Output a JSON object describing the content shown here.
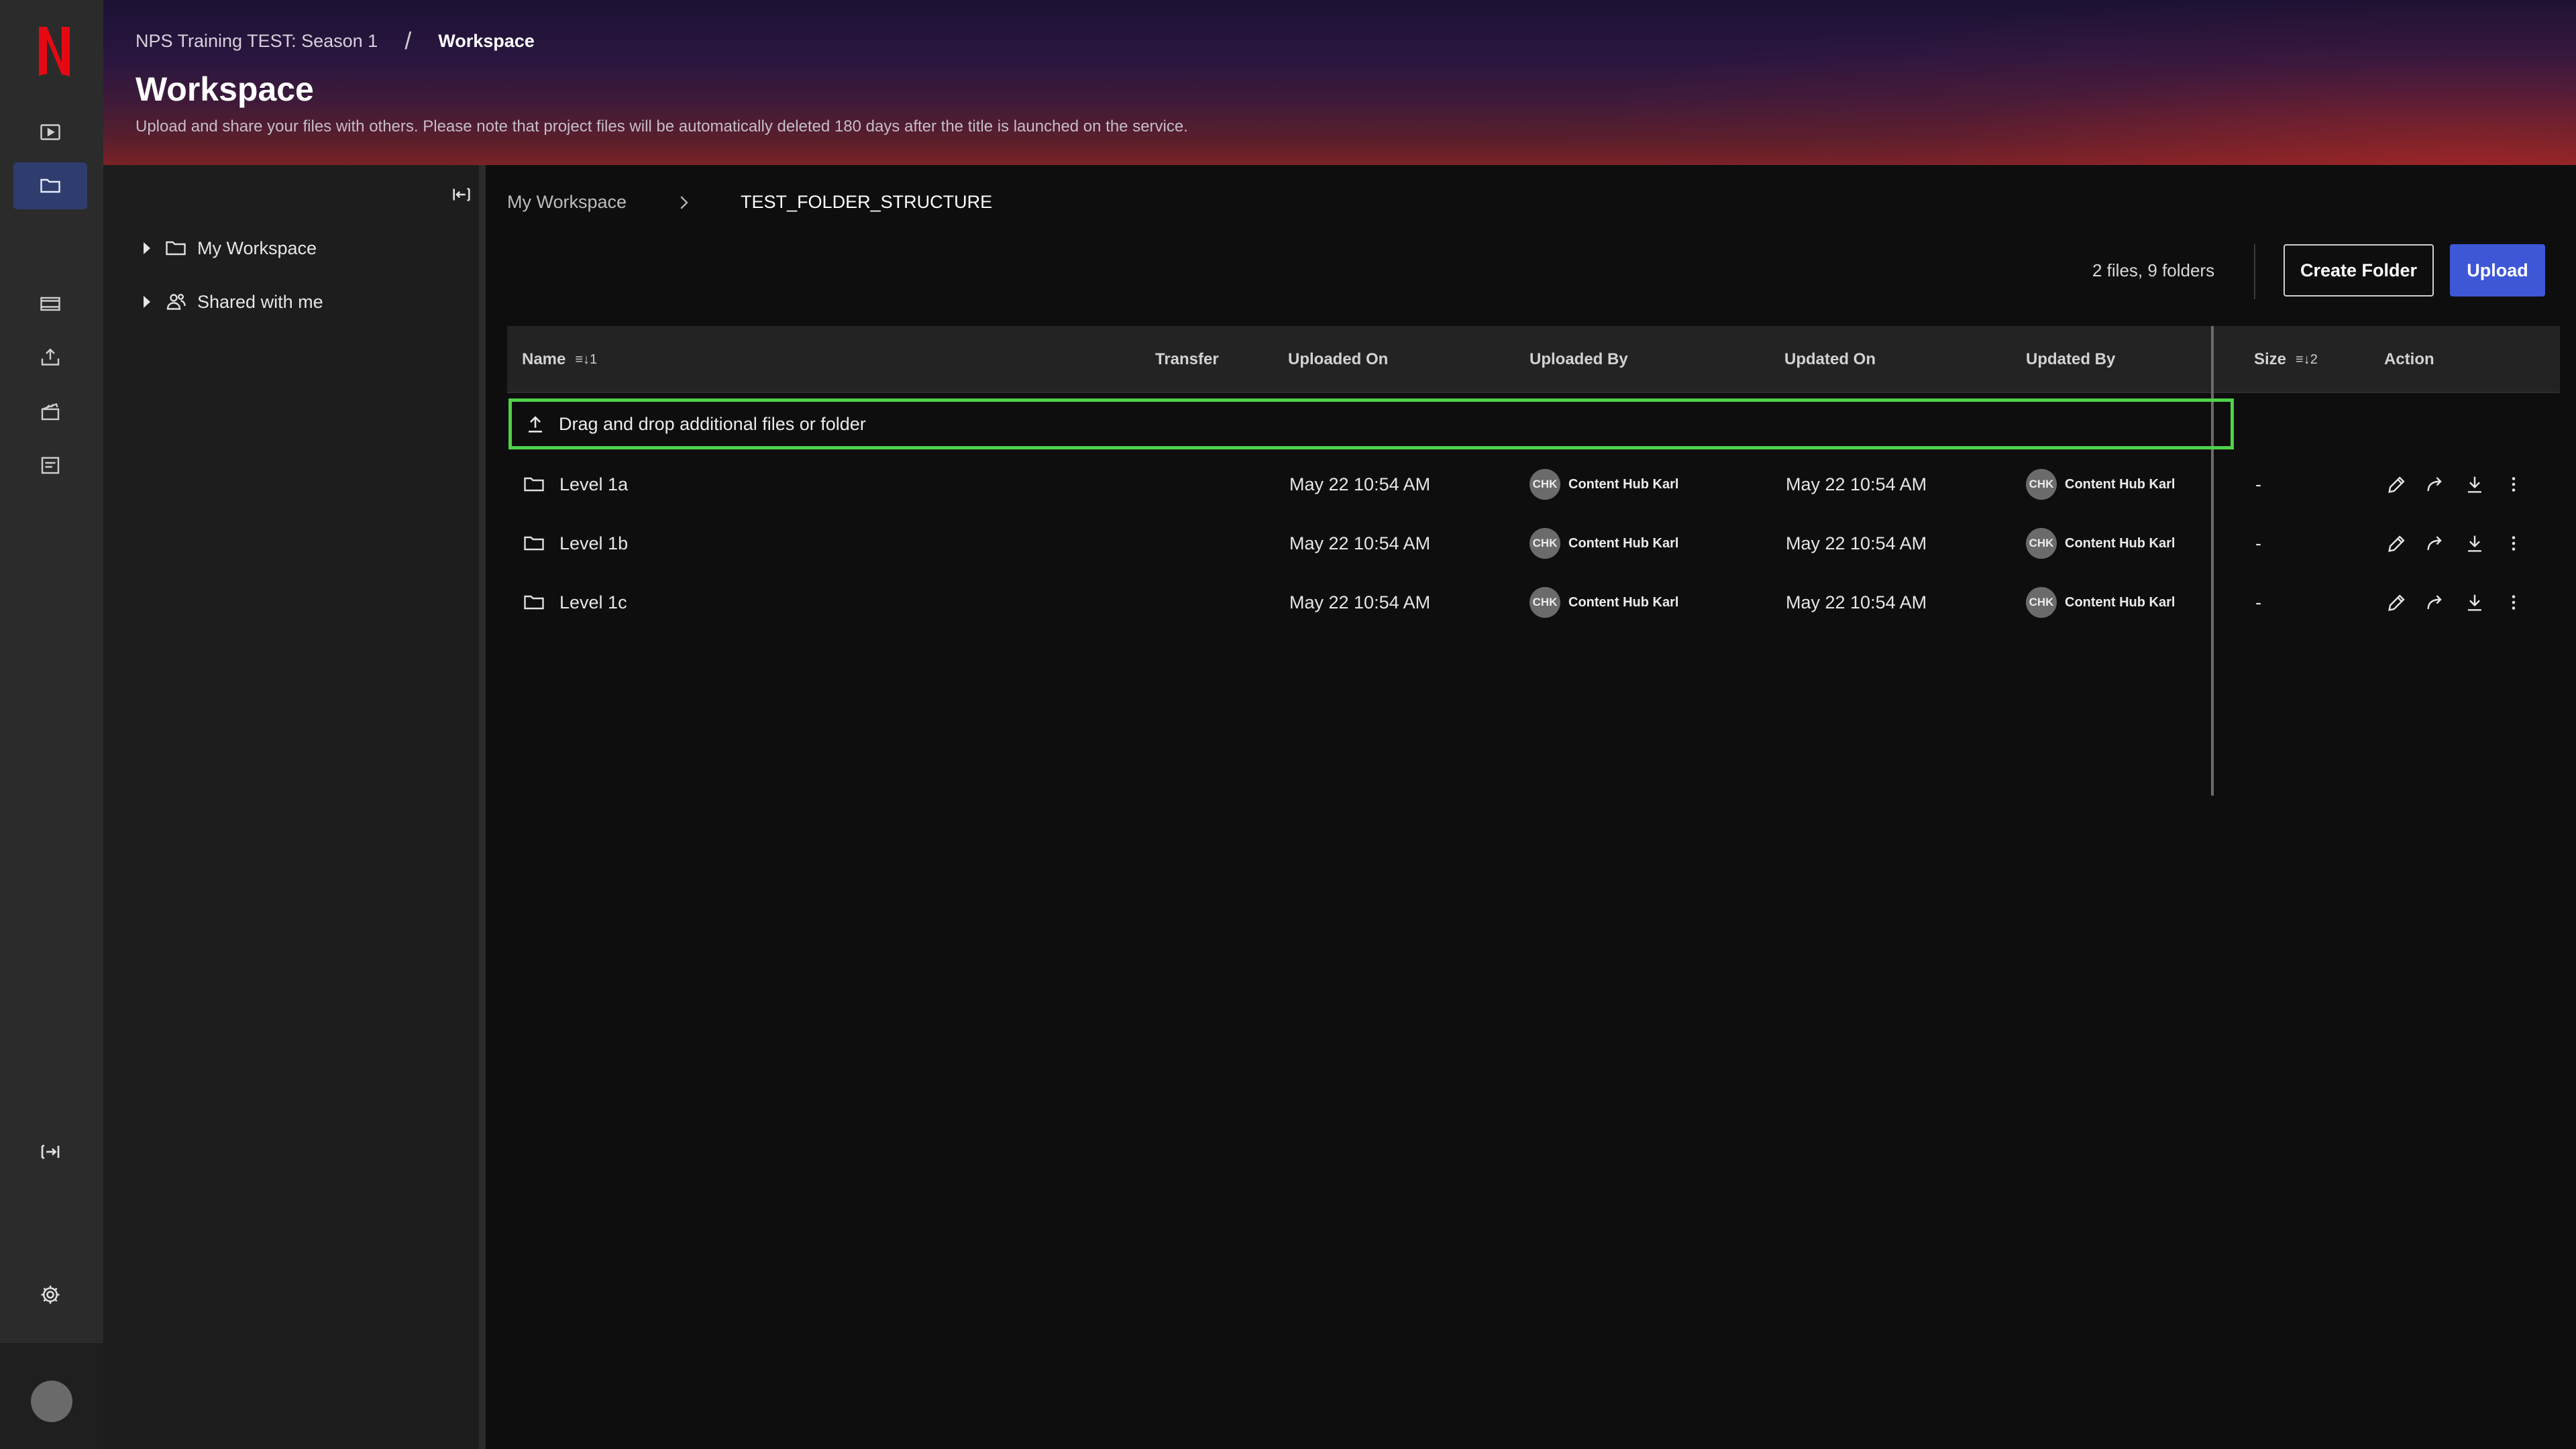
{
  "header": {
    "breadcrumb_project": "NPS Training TEST: Season 1",
    "breadcrumb_separator": "/",
    "breadcrumb_current": "Workspace",
    "title": "Workspace",
    "subtitle": "Upload and share your files with others. Please note that project files will be automatically deleted 180 days after the title is launched on the service."
  },
  "tree": {
    "items": [
      {
        "label": "My Workspace",
        "icon": "folder-icon"
      },
      {
        "label": "Shared with me",
        "icon": "people-icon"
      }
    ]
  },
  "path": {
    "root": "My Workspace",
    "current": "TEST_FOLDER_STRUCTURE"
  },
  "toolbar": {
    "count": "2 files, 9 folders",
    "create_folder": "Create Folder",
    "upload": "Upload"
  },
  "table": {
    "headers": {
      "name": "Name",
      "name_sort": "≡↓1",
      "transfer": "Transfer",
      "uploaded_on": "Uploaded On",
      "uploaded_by": "Uploaded By",
      "updated_on": "Updated On",
      "updated_by": "Updated By",
      "size": "Size",
      "size_sort": "≡↓2",
      "action": "Action"
    },
    "dropzone": "Drag and drop additional files or folder",
    "rows": [
      {
        "name": "Level 1a",
        "uploaded_on": "May 22 10:54 AM",
        "uploaded_by_initials": "CHK",
        "uploaded_by": "Content Hub Karl",
        "updated_on": "May 22 10:54 AM",
        "updated_by_initials": "CHK",
        "updated_by": "Content Hub Karl",
        "size": "-"
      },
      {
        "name": "Level 1b",
        "uploaded_on": "May 22 10:54 AM",
        "uploaded_by_initials": "CHK",
        "uploaded_by": "Content Hub Karl",
        "updated_on": "May 22 10:54 AM",
        "updated_by_initials": "CHK",
        "updated_by": "Content Hub Karl",
        "size": "-"
      },
      {
        "name": "Level 1c",
        "uploaded_on": "May 22 10:54 AM",
        "uploaded_by_initials": "CHK",
        "uploaded_by": "Content Hub Karl",
        "updated_on": "May 22 10:54 AM",
        "updated_by_initials": "CHK",
        "updated_by": "Content Hub Karl",
        "size": "-"
      }
    ]
  },
  "colors": {
    "accent": "#3d57d6",
    "dropzone_border": "#4fd14a",
    "logo_red": "#e50914"
  }
}
